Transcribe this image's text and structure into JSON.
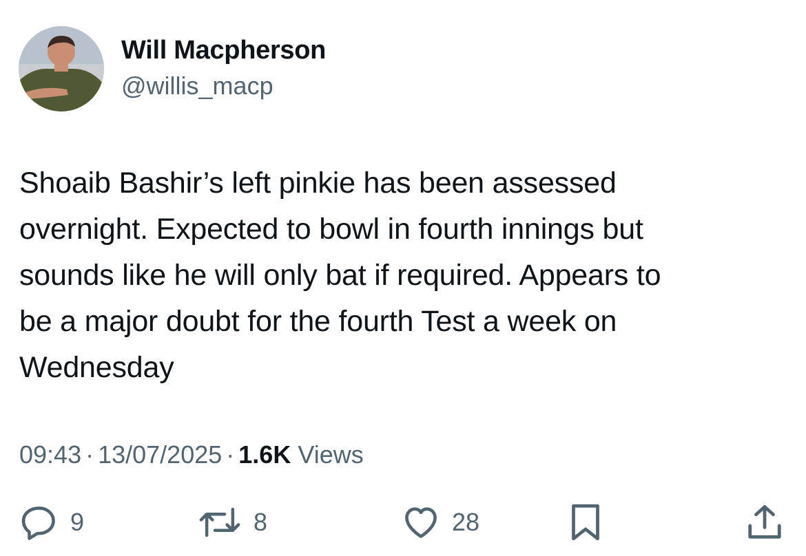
{
  "author": {
    "name": "Will Macpherson",
    "handle": "@willis_macp"
  },
  "tweet": {
    "lines": [
      "Shoaib Bashir’s left pinkie has been assessed",
      "overnight. Expected to bowl in fourth innings but",
      "sounds like he will only bat if required. Appears to",
      "be a major doubt for the fourth Test a week on",
      "Wednesday"
    ]
  },
  "meta": {
    "time": "09:43",
    "date": "13/07/2025",
    "views_count": "1.6K",
    "views_label": "Views",
    "separator": "·"
  },
  "actions": {
    "reply": {
      "icon": "reply-icon",
      "count": "9"
    },
    "retweet": {
      "icon": "retweet-icon",
      "count": "8"
    },
    "like": {
      "icon": "heart-icon",
      "count": "28"
    },
    "bookmark": {
      "icon": "bookmark-icon"
    },
    "share": {
      "icon": "share-icon"
    }
  },
  "colors": {
    "text": "#0f1419",
    "secondary": "#536471",
    "background": "#ffffff"
  }
}
